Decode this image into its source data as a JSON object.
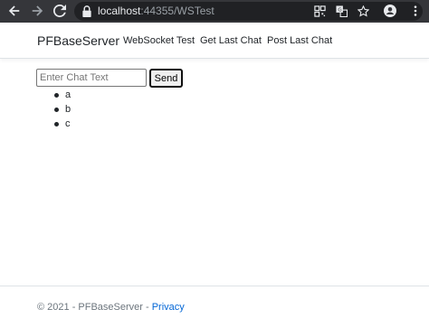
{
  "browser": {
    "url_host": "localhost",
    "url_rest": ":44355/WSTest",
    "icons": [
      "back-icon",
      "forward-icon",
      "reload-icon",
      "lock-icon",
      "qr-code-icon",
      "translate-icon",
      "star-icon",
      "profile-icon",
      "menu-icon"
    ]
  },
  "navbar": {
    "brand": "PFBaseServer",
    "links": [
      "WebSocket Test",
      "Get Last Chat",
      "Post Last Chat"
    ]
  },
  "chat": {
    "input_placeholder": "Enter Chat Text",
    "input_value": "",
    "send_label": "Send",
    "messages": [
      "a",
      "b",
      "c"
    ]
  },
  "footer": {
    "text": "© 2021 - PFBaseServer - ",
    "link": "Privacy"
  },
  "colors": {
    "chrome_bg": "#35363a",
    "omnibox_bg": "#202124",
    "link": "#0366d6",
    "muted_text": "#6c757d"
  }
}
